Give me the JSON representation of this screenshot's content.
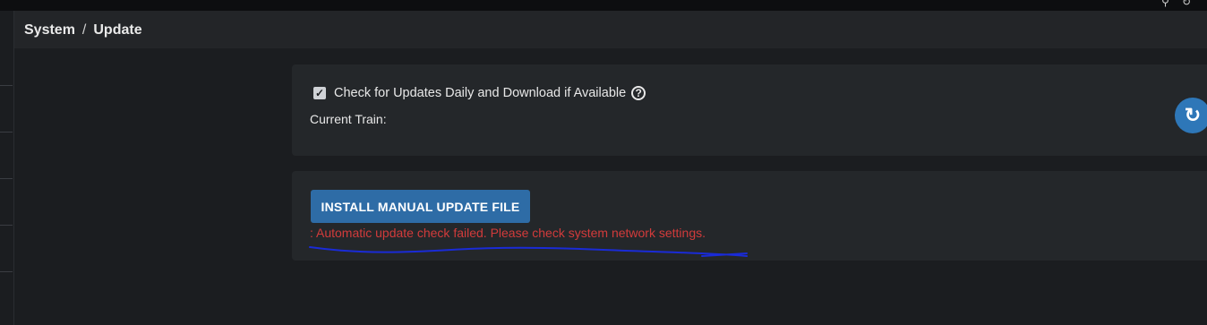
{
  "breadcrumb": {
    "parent": "System",
    "separator": "/",
    "current": "Update"
  },
  "settings": {
    "auto_check_label": "Check for Updates Daily and Download if Available",
    "auto_check_checked": true,
    "current_train_label": "Current Train:"
  },
  "actions": {
    "install_manual_label": "INSTALL MANUAL UPDATE FILE"
  },
  "status": {
    "error_message": ": Automatic update check failed. Please check system network settings."
  },
  "icons": {
    "checkbox": "check-icon",
    "help": "help-circle-icon",
    "refresh": "refresh-icon"
  },
  "colors": {
    "background": "#1b1d20",
    "card": "#24272a",
    "primary": "#2e6ca6",
    "error": "#d23b3b",
    "annotation": "#1a2bd6"
  }
}
